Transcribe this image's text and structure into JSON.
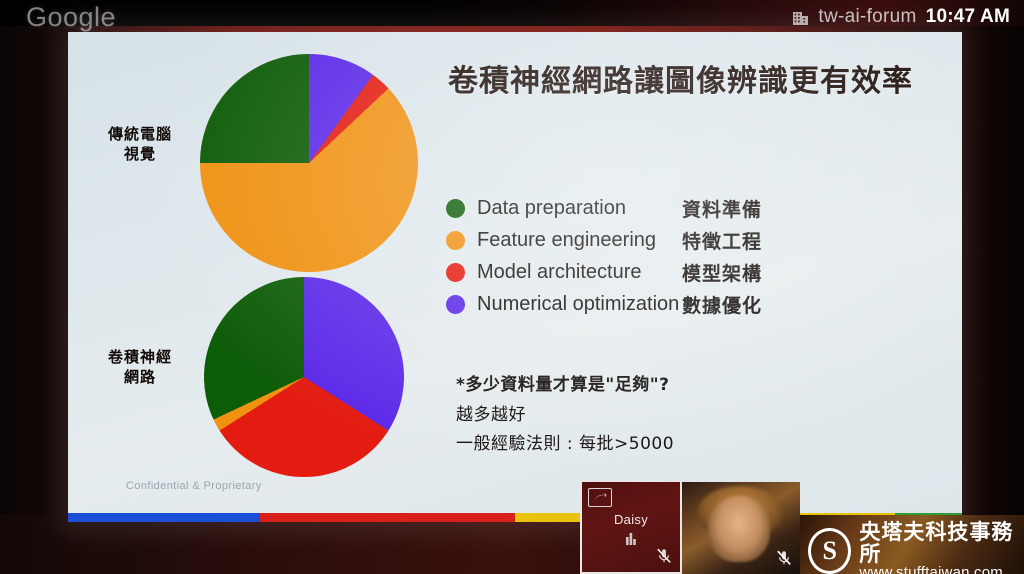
{
  "watermark": {
    "text": "Google"
  },
  "statusbar": {
    "org_icon": "building-icon",
    "meeting_name": "tw-ai-forum",
    "time": "10:47 AM"
  },
  "slide": {
    "title": "卷積神經網路讓圖像辨識更有效率",
    "pie_labels": {
      "top_line1": "傳統電腦",
      "top_line2": "視覺",
      "bottom_line1": "卷積神經",
      "bottom_line2": "網路"
    },
    "legend": [
      {
        "label_en": "Data preparation",
        "label_zh": "資料準備",
        "color": "#0d5c08"
      },
      {
        "label_en": "Feature engineering",
        "label_zh": "特徵工程",
        "color": "#ef9111"
      },
      {
        "label_en": "Model architecture",
        "label_zh": "模型架構",
        "color": "#e31b10"
      },
      {
        "label_en": "Numerical optimization",
        "label_zh": "數據優化",
        "color": "#5b28e8"
      }
    ],
    "footnote": {
      "heading": "*多少資料量才算是\"足夠\"?",
      "line2": "越多越好",
      "line3": "一般經驗法則 : 每批>5000"
    },
    "footer": {
      "confidential": "Confidential & Proprietary"
    },
    "colorbar": [
      {
        "name": "blue",
        "color": "#1b4fd8",
        "width_pct": 21.5
      },
      {
        "name": "red",
        "color": "#d8201a",
        "width_pct": 28.5
      },
      {
        "name": "yellow",
        "color": "#e8c20c",
        "width_pct": 42.5
      },
      {
        "name": "green",
        "color": "#2f9b35",
        "width_pct": 7.5
      }
    ]
  },
  "chart_data": [
    {
      "type": "pie",
      "title": "傳統電腦視覺",
      "categories": [
        "Numerical optimization",
        "Model architecture",
        "Feature engineering",
        "Data preparation"
      ],
      "values": [
        10,
        3,
        62,
        25
      ],
      "colors": [
        "#5b28e8",
        "#e31b10",
        "#ef9111",
        "#0d5c08"
      ],
      "units": "percent",
      "legend_position": "right",
      "grid": false
    },
    {
      "type": "pie",
      "title": "卷積神經網路",
      "categories": [
        "Numerical optimization",
        "Model architecture",
        "Feature engineering",
        "Data preparation"
      ],
      "values": [
        34,
        32,
        2,
        32
      ],
      "colors": [
        "#5b28e8",
        "#e31b10",
        "#ef9111",
        "#0d5c08"
      ],
      "units": "percent",
      "legend_position": "right",
      "grid": false
    }
  ],
  "tiles": {
    "daisy": {
      "name": "Daisy",
      "present_icon": "screen-share-icon",
      "chart_icon": "presentation-chart-icon",
      "mic_icon": "mic-off-icon"
    },
    "participant": {
      "mic_icon": "mic-off-icon"
    },
    "brand": {
      "logo_letter": "S",
      "name_zh": "央塔夫科技事務所",
      "url": "www.stufftaiwan.com"
    }
  }
}
